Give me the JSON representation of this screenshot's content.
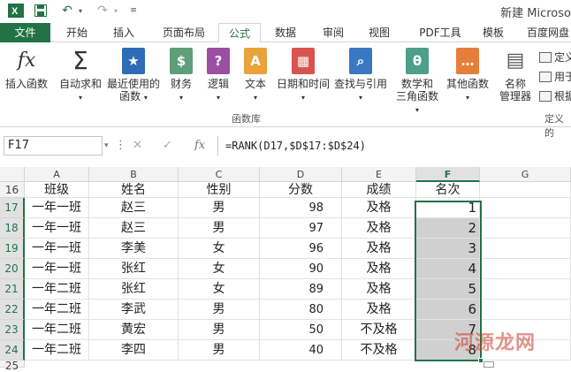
{
  "titlebar": {
    "title": "新建 Microso"
  },
  "tabs": [
    "文件",
    "开始",
    "插入",
    "页面布局",
    "公式",
    "数据",
    "审阅",
    "视图",
    "PDF工具",
    "模板",
    "百度网盘"
  ],
  "ribbon": {
    "buttons": [
      {
        "label": "插入函数",
        "icon": "fx"
      },
      {
        "label": "自动求和",
        "icon": "Σ"
      },
      {
        "label": "最近使用的\n函数",
        "icon": "★"
      },
      {
        "label": "财务",
        "icon": "$"
      },
      {
        "label": "逻辑",
        "icon": "?"
      },
      {
        "label": "文本",
        "icon": "A"
      },
      {
        "label": "日期和时间",
        "icon": "▦"
      },
      {
        "label": "查找与引用",
        "icon": "🔍"
      },
      {
        "label": "数学和\n三角函数",
        "icon": "θ"
      },
      {
        "label": "其他函数",
        "icon": "…"
      },
      {
        "label": "名称\n管理器",
        "icon": "▤"
      }
    ],
    "small": [
      "定义",
      "用于",
      "根据"
    ],
    "group_label": "函数库",
    "group_label2": "定义的"
  },
  "formula_bar": {
    "name_box": "F17",
    "formula": "=RANK(D17,$D$17:$D$24)"
  },
  "columns": [
    "A",
    "B",
    "C",
    "D",
    "E",
    "F",
    "G"
  ],
  "header_row": {
    "row": "16",
    "cells": [
      "班级",
      "姓名",
      "性别",
      "分数",
      "成绩",
      "名次"
    ]
  },
  "rows": [
    {
      "row": "17",
      "class": "一年一班",
      "name": "赵三",
      "gender": "男",
      "score": "98",
      "grade": "及格",
      "rank": "1"
    },
    {
      "row": "18",
      "class": "一年一班",
      "name": "赵三",
      "gender": "男",
      "score": "97",
      "grade": "及格",
      "rank": "2"
    },
    {
      "row": "19",
      "class": "一年一班",
      "name": "李美",
      "gender": "女",
      "score": "96",
      "grade": "及格",
      "rank": "3"
    },
    {
      "row": "20",
      "class": "一年一班",
      "name": "张红",
      "gender": "女",
      "score": "90",
      "grade": "及格",
      "rank": "4"
    },
    {
      "row": "21",
      "class": "一年二班",
      "name": "张红",
      "gender": "女",
      "score": "89",
      "grade": "及格",
      "rank": "5"
    },
    {
      "row": "22",
      "class": "一年二班",
      "name": "李武",
      "gender": "男",
      "score": "80",
      "grade": "及格",
      "rank": "6"
    },
    {
      "row": "23",
      "class": "一年二班",
      "name": "黄宏",
      "gender": "男",
      "score": "50",
      "grade": "不及格",
      "rank": "7"
    },
    {
      "row": "24",
      "class": "一年二班",
      "name": "李四",
      "gender": "男",
      "score": "40",
      "grade": "不及格",
      "rank": "8"
    }
  ],
  "partial_row": "25",
  "watermark": "河源龙网",
  "colors": {
    "accent": "#217346",
    "selection_fill": "#d0d0d0"
  }
}
